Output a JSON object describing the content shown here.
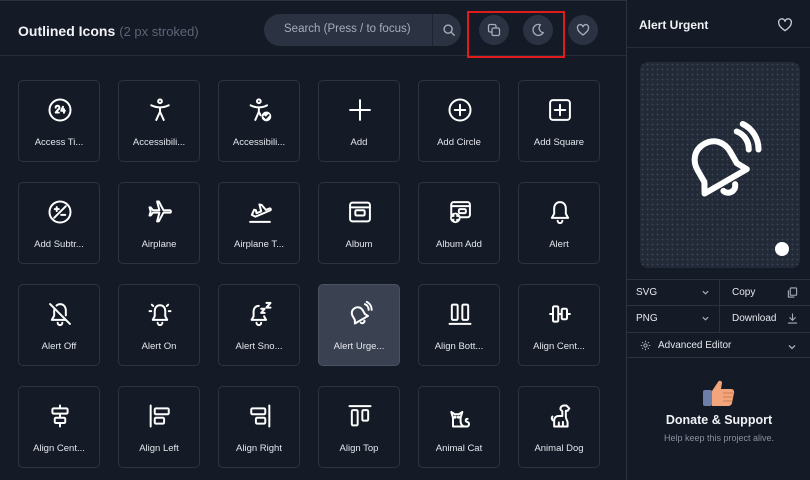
{
  "header": {
    "title": "Outlined Icons",
    "subtitle": "(2 px stroked)",
    "search_placeholder": "Search (Press / to focus)"
  },
  "icons": [
    {
      "label": "Access Ti...",
      "icon": "access-time-icon"
    },
    {
      "label": "Accessibili...",
      "icon": "accessibility-icon"
    },
    {
      "label": "Accessibili...",
      "icon": "accessibility-check-icon"
    },
    {
      "label": "Add",
      "icon": "add-icon"
    },
    {
      "label": "Add Circle",
      "icon": "add-circle-icon"
    },
    {
      "label": "Add Square",
      "icon": "add-square-icon"
    },
    {
      "label": "Add Subtr...",
      "icon": "add-subtract-icon"
    },
    {
      "label": "Airplane",
      "icon": "airplane-icon"
    },
    {
      "label": "Airplane T...",
      "icon": "airplane-takeoff-icon"
    },
    {
      "label": "Album",
      "icon": "album-icon"
    },
    {
      "label": "Album Add",
      "icon": "album-add-icon"
    },
    {
      "label": "Alert",
      "icon": "alert-icon"
    },
    {
      "label": "Alert Off",
      "icon": "alert-off-icon"
    },
    {
      "label": "Alert On",
      "icon": "alert-on-icon"
    },
    {
      "label": "Alert Sno...",
      "icon": "alert-snooze-icon"
    },
    {
      "label": "Alert Urge...",
      "icon": "alert-urgent-icon",
      "selected": true
    },
    {
      "label": "Align Bott...",
      "icon": "align-bottom-icon"
    },
    {
      "label": "Align Cent...",
      "icon": "align-center-vertical-icon"
    },
    {
      "label": "Align Cent...",
      "icon": "align-center-horizontal-icon"
    },
    {
      "label": "Align Left",
      "icon": "align-left-icon"
    },
    {
      "label": "Align Right",
      "icon": "align-right-icon"
    },
    {
      "label": "Align Top",
      "icon": "align-top-icon"
    },
    {
      "label": "Animal Cat",
      "icon": "animal-cat-icon"
    },
    {
      "label": "Animal Dog",
      "icon": "animal-dog-icon"
    }
  ],
  "side": {
    "title": "Alert Urgent",
    "format1": "SVG",
    "copy_label": "Copy",
    "format2": "PNG",
    "download_label": "Download",
    "advanced_label": "Advanced Editor",
    "donate_title": "Donate & Support",
    "donate_sub": "Help keep this project alive."
  },
  "colors": {
    "background": "#141a26",
    "tile_border": "#2c3342",
    "selected_tile": "#3a4252",
    "highlight": "#e01b1b"
  }
}
